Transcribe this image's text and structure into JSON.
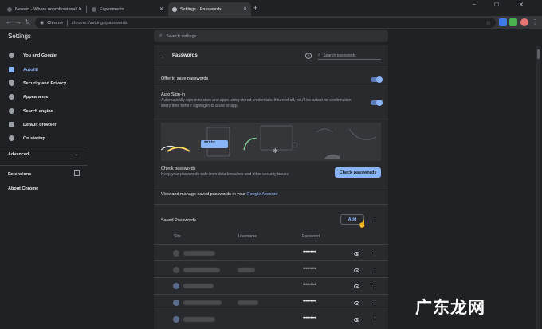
{
  "browser": {
    "tabs": [
      {
        "label": "Neowin - Where unprofessional",
        "active": false
      },
      {
        "label": "Experiments",
        "active": false
      },
      {
        "label": "Settings - Passwords",
        "active": true
      }
    ],
    "url_prefix": "Chrome",
    "url": "chrome://settings/passwords",
    "window_controls": [
      "–",
      "☐",
      "✕"
    ]
  },
  "settings": {
    "title": "Settings",
    "search_placeholder": "Search settings"
  },
  "sidebar": {
    "items": [
      {
        "label": "You and Google",
        "icon": "person-icon",
        "active": false
      },
      {
        "label": "Autofill",
        "icon": "autofill-icon",
        "active": true
      },
      {
        "label": "Security and Privacy",
        "icon": "shield-icon",
        "active": false
      },
      {
        "label": "Appearance",
        "icon": "palette-icon",
        "active": false
      },
      {
        "label": "Search engine",
        "icon": "search-icon",
        "active": false
      },
      {
        "label": "Default browser",
        "icon": "browser-icon",
        "active": false
      },
      {
        "label": "On startup",
        "icon": "power-icon",
        "active": false
      }
    ],
    "advanced": "Advanced",
    "extensions": "Extensions",
    "about": "About Chrome"
  },
  "passwords": {
    "page_title": "Passwords",
    "search_placeholder": "Search passwords",
    "offer_to_save": "Offer to save passwords",
    "offer_to_save_on": true,
    "auto_signin_title": "Auto Sign-in",
    "auto_signin_desc": "Automatically sign in to sites and apps using stored credentials. If turned off, you'll be asked for confirmation every time before signing in to a site or app.",
    "auto_signin_on": true,
    "illustration_dots": "*****",
    "check_title": "Check passwords",
    "check_desc": "Keep your passwords safe from data breaches and other security issues",
    "check_button": "Check passwords",
    "manage_text": "View and manage saved passwords in your ",
    "manage_link": "Google Account",
    "saved_title": "Saved Passwords",
    "add_button": "Add",
    "columns": {
      "site": "Site",
      "username": "Username",
      "password": "Password"
    },
    "rows": [
      {
        "password": "••••••••••",
        "has_username": false
      },
      {
        "password": "••••••••••",
        "has_username": true
      },
      {
        "password": "••••••••••",
        "has_username": false
      },
      {
        "password": "••••••••••",
        "has_username": true
      },
      {
        "password": "••••••••••",
        "has_username": false
      }
    ]
  },
  "watermark": "广东龙网",
  "colors": {
    "accent": "#8ab4f8",
    "background": "#202124",
    "card": "#292a2d"
  }
}
